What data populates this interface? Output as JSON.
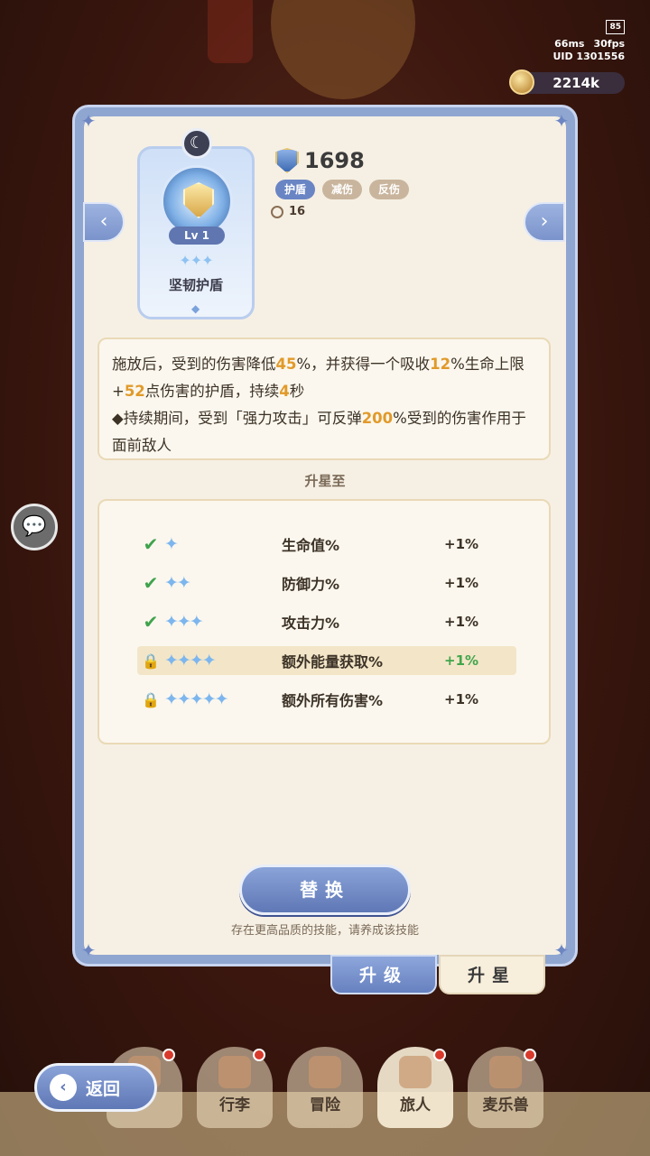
{
  "hud": {
    "battery": "85",
    "ping": "66ms",
    "fps": "30fps",
    "uid": "UID 1301556"
  },
  "currency": {
    "amount": "2214k"
  },
  "skill": {
    "level": "Lv 1",
    "stars": "✦✦✦",
    "name": "坚韧护盾",
    "power": "1698",
    "tags": [
      "护盾",
      "减伤",
      "反伤"
    ],
    "cooldown": "16"
  },
  "description": {
    "p1_a": "施放后，受到的伤害降低",
    "p1_v1": "45",
    "p1_b": "%，并获得一个吸收",
    "p1_v2": "12",
    "p1_c": "%生命上限+",
    "p1_v3": "52",
    "p1_d": "点伤害的护盾，持续",
    "p1_v4": "4",
    "p1_e": "秒",
    "p2_a": "◆持续期间，受到「强力攻击」可反弹",
    "p2_v1": "200",
    "p2_b": "%受到的伤害作用于面前敌人"
  },
  "star_section": {
    "title": "升星至",
    "rows": [
      {
        "status": "✔",
        "stars": "✦",
        "label": "生命值%",
        "bonus": "+1%"
      },
      {
        "status": "✔",
        "stars": "✦✦",
        "label": "防御力%",
        "bonus": "+1%"
      },
      {
        "status": "✔",
        "stars": "✦✦✦",
        "label": "攻击力%",
        "bonus": "+1%"
      },
      {
        "status": "🔒",
        "stars": "✦✦✦✦",
        "label": "额外能量获取%",
        "bonus": "+1%"
      },
      {
        "status": "🔒",
        "stars": "✦✦✦✦✦",
        "label": "额外所有伤害%",
        "bonus": "+1%"
      }
    ]
  },
  "replace_button": "替换",
  "hint": "存在更高品质的技能，请养成该技能",
  "tabs": {
    "upgrade": "升级",
    "star": "升星"
  },
  "back_button": "返回",
  "nav": [
    "行李",
    "冒险",
    "旅人",
    "麦乐兽"
  ],
  "colors": {
    "accent": "#6a85c4",
    "highlight": "#e19a2a",
    "panel_bg": "#f6f0e4"
  }
}
